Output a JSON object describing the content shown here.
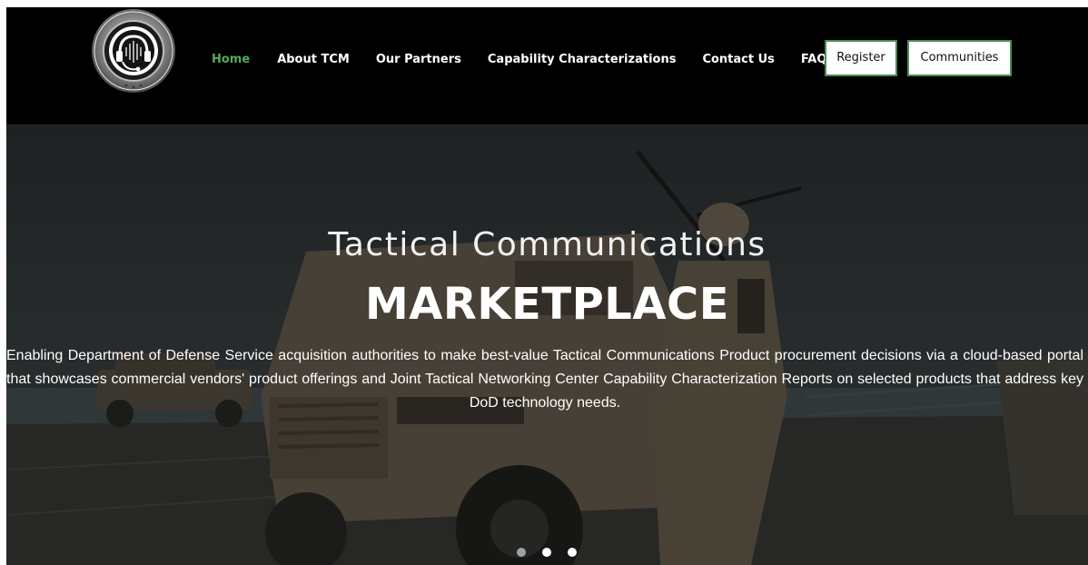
{
  "header": {
    "logo": {
      "icon": "tcm-seal-logo",
      "ring_text": "TACTICAL COMMUNICATIONS MARKETPLACE"
    },
    "nav": [
      {
        "label": "Home",
        "active": true
      },
      {
        "label": "About TCM",
        "active": false
      },
      {
        "label": "Our Partners",
        "active": false
      },
      {
        "label": "Capability Characterizations",
        "active": false
      },
      {
        "label": "Contact Us",
        "active": false
      },
      {
        "label": "FAQs",
        "active": false
      }
    ],
    "register_label": "Register",
    "communities_label": "Communities"
  },
  "hero": {
    "title": "Tactical Communications",
    "subtitle": "MARKETPLACE",
    "description": "Enabling Department of Defense Service acquisition authorities to make best-value Tactical Communications Product procurement decisions via a cloud-based portal that showcases commercial vendors' product offerings and Joint Tactical Networking Center Capability Characterization Reports on selected products that address key DoD technology needs.",
    "carousel": {
      "slides": 3,
      "active_index": 0
    }
  },
  "colors": {
    "header_bg": "#000000",
    "nav_active": "#57a95b",
    "button_border": "#4a8f52",
    "hero_overlay": "#2b3134"
  }
}
